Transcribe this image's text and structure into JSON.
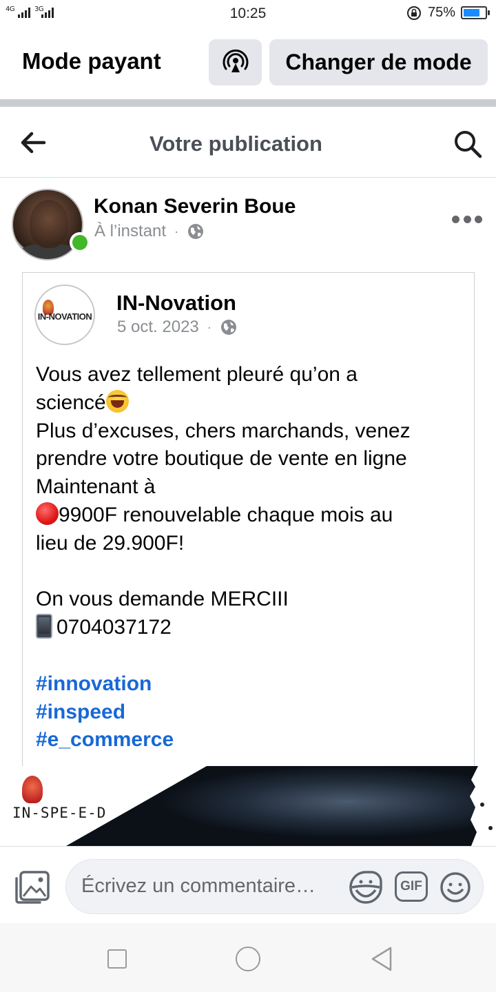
{
  "status_bar": {
    "network_1": "4G",
    "network_2": "3G",
    "time": "10:25",
    "battery_percent": "75%",
    "battery_level": 0.75
  },
  "mode_bar": {
    "title": "Mode payant",
    "broadcast_icon": "broadcast-icon",
    "change_mode_label": "Changer de mode"
  },
  "header": {
    "back_icon": "back-arrow-icon",
    "title": "Votre publication",
    "search_icon": "search-icon"
  },
  "post": {
    "author": "Konan Severin Boue",
    "time": "À l’instant",
    "separator": "·",
    "privacy_icon": "globe-icon",
    "online": true,
    "more_icon": "more-icon",
    "shared": {
      "page_name": "IN-Novation",
      "page_logo_text": "IN-NOVATION",
      "date": "5 oct. 2023",
      "separator": "·",
      "privacy_icon": "globe-icon",
      "body": {
        "line_1": "Vous avez tellement pleuré qu’on a",
        "line_2": "sciencé",
        "line_3": "Plus d’excuses, chers marchands, venez",
        "line_4": "prendre votre boutique de vente en ligne",
        "line_5": "Maintenant à",
        "line_6": "9900F renouvelable chaque mois au",
        "line_7": "lieu de 29.900F!",
        "line_8": "On vous  demande MERCIII",
        "line_9": "0704037172"
      },
      "emojis": [
        "laughing-crying-emoji",
        "red-circle-emoji",
        "mobile-phone-emoji"
      ],
      "hashtags": [
        "#innovation",
        "#inspeed",
        "#e_commerce"
      ]
    },
    "banner": {
      "logo_text": "IN-SPE-E-D"
    }
  },
  "comment_bar": {
    "photo_icon": "photo-icon",
    "placeholder": "Écrivez un commentaire…",
    "sticker_icon": "sticker-icon",
    "gif_label": "GIF",
    "emoji_icon": "emoji-icon"
  },
  "nav_bar": {
    "buttons": [
      "recent-apps-button",
      "home-button",
      "back-button"
    ]
  },
  "colors": {
    "link_blue": "#1868d6",
    "online_green": "#42b72a",
    "button_gray": "#e4e6eb",
    "meta_gray": "#8a8d91",
    "separator_gray": "#c9ccd1"
  }
}
